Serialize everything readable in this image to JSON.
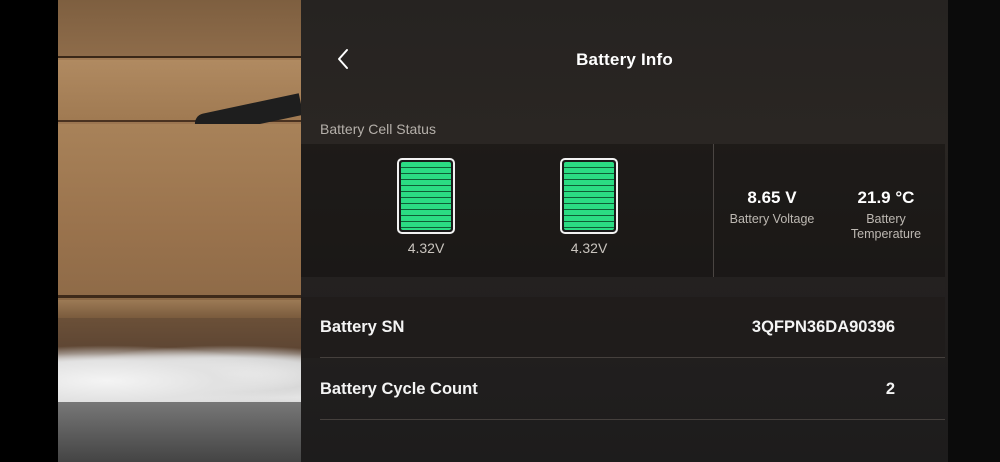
{
  "header": {
    "title": "Battery Info",
    "back_icon": "chevron-left-icon"
  },
  "cell_status": {
    "section_label": "Battery Cell Status",
    "cells": [
      {
        "voltage": "4.32V"
      },
      {
        "voltage": "4.32V"
      }
    ],
    "cell_color": "#2bdc83"
  },
  "stats": {
    "voltage": {
      "value": "8.65 V",
      "label": "Battery Voltage"
    },
    "temperature": {
      "value": "21.9 °C",
      "label_line1": "Battery",
      "label_line2": "Temperature"
    }
  },
  "details": {
    "serial": {
      "label": "Battery SN",
      "value": "3QFPN36DA90396"
    },
    "cycle_count": {
      "label": "Battery Cycle Count",
      "value": "2"
    }
  }
}
